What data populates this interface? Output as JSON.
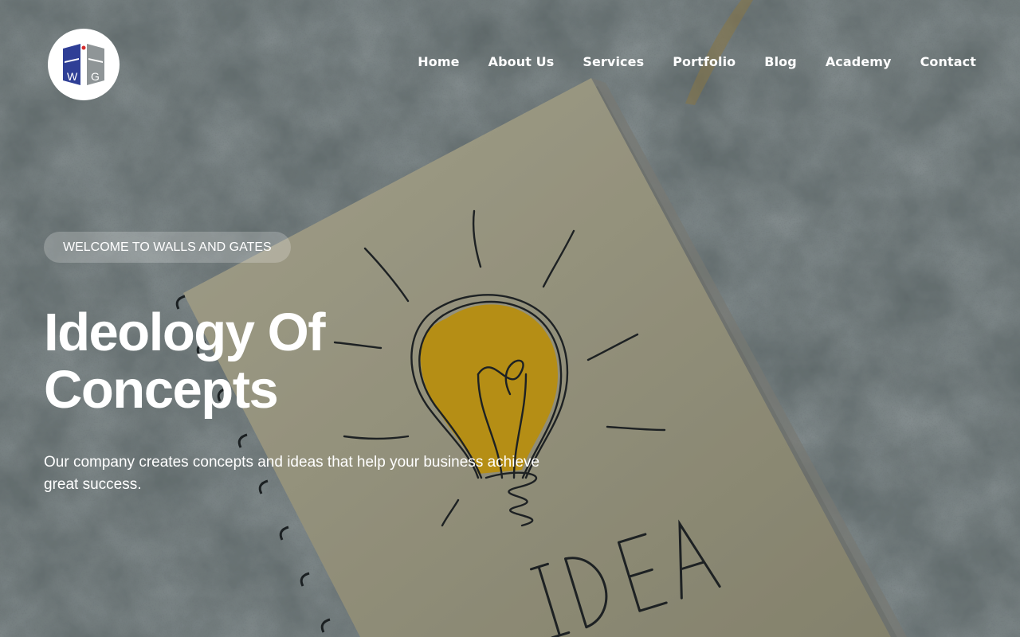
{
  "logo": {
    "letters": [
      "W",
      "G"
    ],
    "colors": {
      "primary": "#2f3f96",
      "secondary": "#8f9597",
      "accent": "#d62b2b"
    }
  },
  "nav": {
    "items": [
      {
        "label": "Home"
      },
      {
        "label": "About Us"
      },
      {
        "label": "Services"
      },
      {
        "label": "Portfolio"
      },
      {
        "label": "Blog"
      },
      {
        "label": "Academy"
      },
      {
        "label": "Contact"
      }
    ]
  },
  "hero": {
    "badge": "WELCOME TO WALLS AND GATES",
    "title_lines": [
      "Ideology Of",
      "Concepts"
    ],
    "subtitle": "Our company creates concepts and ideas that help your business achieve great success.",
    "background_image": {
      "description_icon": "lightbulb-notebook-image",
      "notebook_text": "IDEA"
    }
  },
  "theme": {
    "text": "#ffffff",
    "backdrop": "#566062",
    "notebook": "#cfcab0",
    "bulb": "#e2b016"
  }
}
